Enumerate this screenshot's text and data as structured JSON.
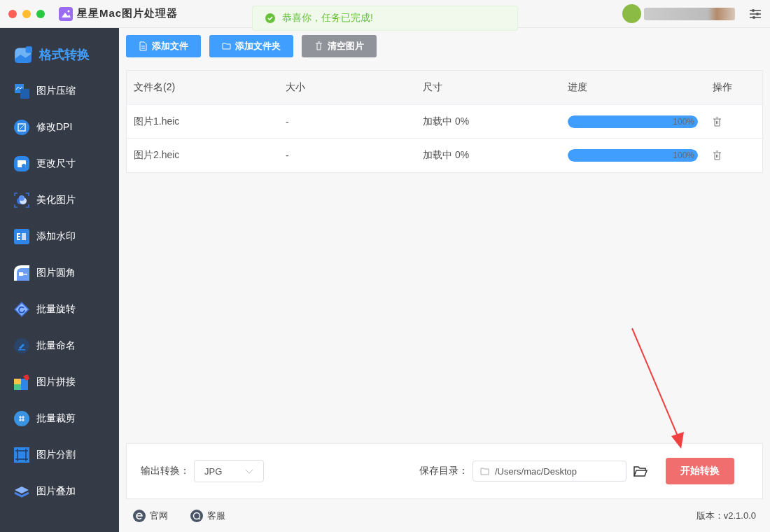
{
  "window": {
    "title": "星星Mac图片处理器"
  },
  "toast": {
    "text": "恭喜你，任务已完成!"
  },
  "sidebar": {
    "items": [
      {
        "label": "格式转换",
        "selected": true
      },
      {
        "label": "图片压缩",
        "selected": false
      },
      {
        "label": "修改DPI",
        "selected": false
      },
      {
        "label": "更改尺寸",
        "selected": false
      },
      {
        "label": "美化图片",
        "selected": false
      },
      {
        "label": "添加水印",
        "selected": false
      },
      {
        "label": "图片圆角",
        "selected": false
      },
      {
        "label": "批量旋转",
        "selected": false
      },
      {
        "label": "批量命名",
        "selected": false
      },
      {
        "label": "图片拼接",
        "selected": false
      },
      {
        "label": "批量裁剪",
        "selected": false
      },
      {
        "label": "图片分割",
        "selected": false
      },
      {
        "label": "图片叠加",
        "selected": false
      }
    ]
  },
  "toolbar": [
    {
      "label": "添加文件",
      "kind": "primary"
    },
    {
      "label": "添加文件夹",
      "kind": "primary"
    },
    {
      "label": "清空图片",
      "kind": "secondary"
    }
  ],
  "table": {
    "columns": [
      "文件名(2)",
      "大小",
      "尺寸",
      "进度",
      "操作"
    ],
    "rows": [
      {
        "name": "图片1.heic",
        "size": "-",
        "dimensions": "加载中 0%",
        "level": 1,
        "reading": "100%"
      },
      {
        "name": "图片2.heic",
        "size": "-",
        "dimensions": "加载中 0%",
        "level": 1,
        "reading": "100%"
      }
    ]
  },
  "settings": {
    "format_label": "输出转换：",
    "format_value": "JPG",
    "save_label": "保存目录：",
    "save_path": "/Users/mac/Desktop",
    "start_button": "开始转换"
  },
  "footer": {
    "links": [
      "官网",
      "客服"
    ],
    "version": "版本：v2.1.0.0"
  }
}
